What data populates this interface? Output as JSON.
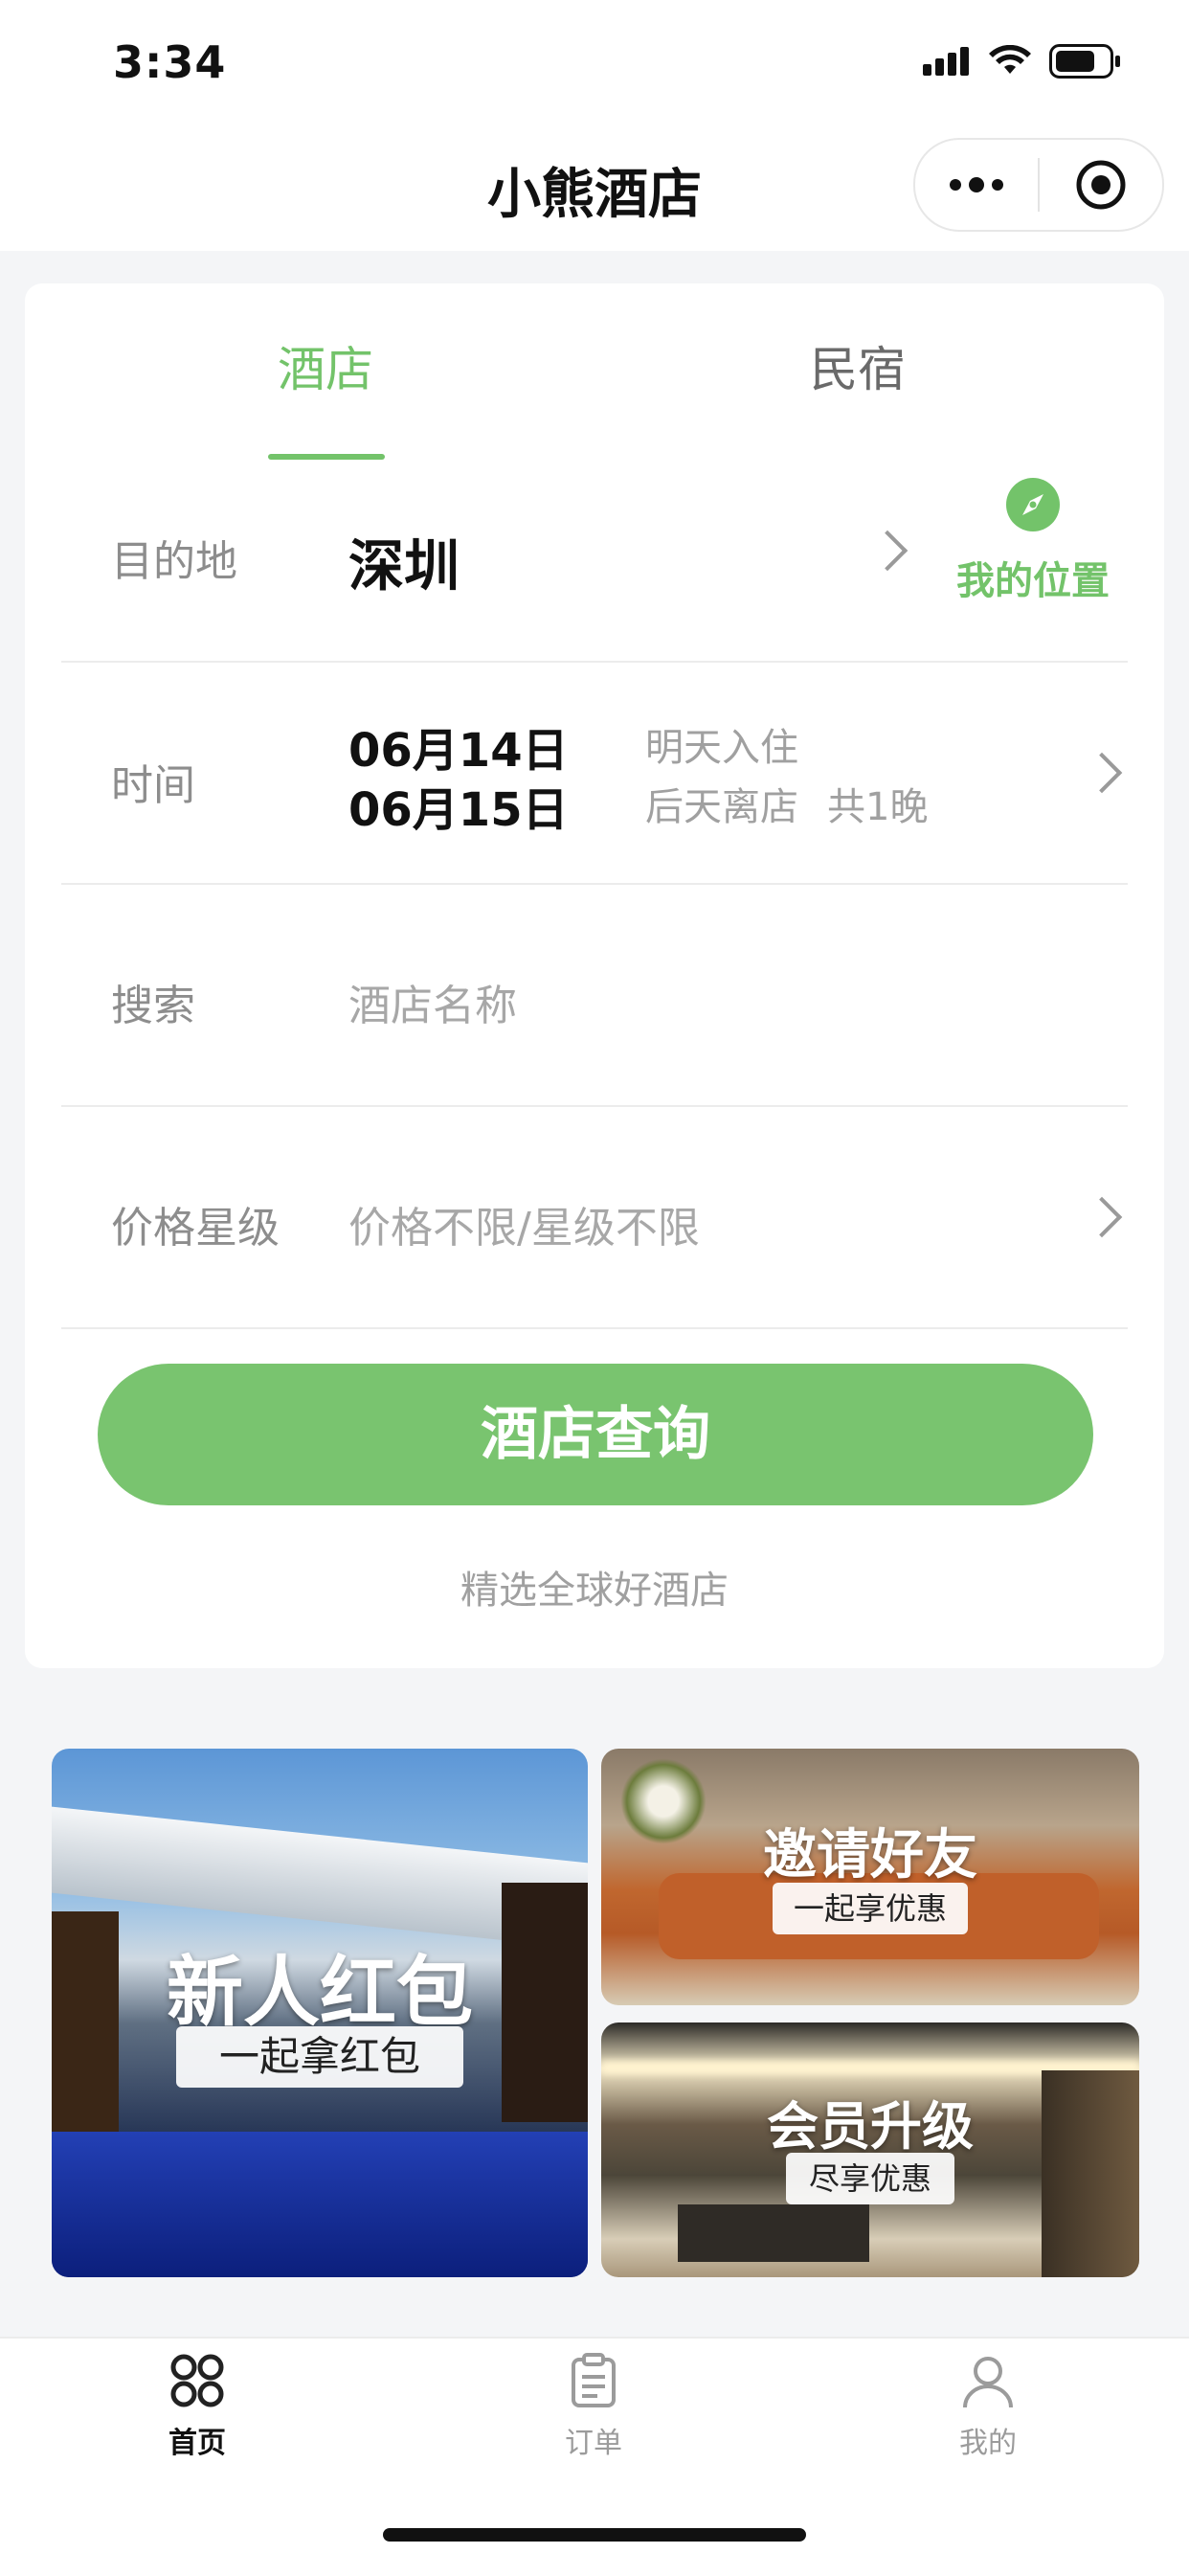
{
  "status_bar": {
    "time": "3:34"
  },
  "nav": {
    "title": "小熊酒店",
    "more_icon": "more-dots-icon",
    "target_icon": "target-icon"
  },
  "tabs": [
    {
      "label": "酒店",
      "active": true
    },
    {
      "label": "民宿",
      "active": false
    }
  ],
  "form": {
    "destination": {
      "label": "目的地",
      "value": "深圳",
      "location_label": "我的位置"
    },
    "time": {
      "label": "时间",
      "checkin_date": "06月14日",
      "checkin_hint": "明天入住",
      "checkout_date": "06月15日",
      "checkout_hint": "后天离店",
      "nights": "共1晚"
    },
    "search": {
      "label": "搜索",
      "placeholder": "酒店名称"
    },
    "price": {
      "label": "价格星级",
      "placeholder": "价格不限/星级不限"
    }
  },
  "search_button": "酒店查询",
  "caption": "精选全球好酒店",
  "banners": {
    "new_user": {
      "title": "新人红包",
      "subtitle": "一起拿红包"
    },
    "invite": {
      "title": "邀请好友",
      "subtitle": "一起享优惠"
    },
    "vip": {
      "title": "会员升级",
      "subtitle": "尽享优惠"
    }
  },
  "tabbar": [
    {
      "label": "首页",
      "icon": "home-grid-icon",
      "active": true
    },
    {
      "label": "订单",
      "icon": "clipboard-icon",
      "active": false
    },
    {
      "label": "我的",
      "icon": "user-icon",
      "active": false
    }
  ],
  "colors": {
    "accent": "#79c46f",
    "accent_text": "#73c36a"
  }
}
